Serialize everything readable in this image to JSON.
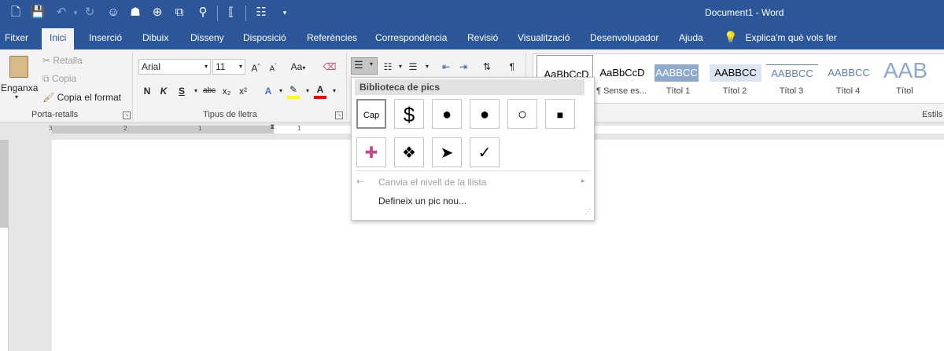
{
  "window": {
    "title": "Document1  -  Word"
  },
  "qat": {
    "icons": [
      "new-document-icon",
      "save-icon",
      "undo-icon",
      "redo-icon",
      "smiley-icon",
      "globe-icon",
      "zoom-icon",
      "copy-icon",
      "user-icon",
      "bracket-icon",
      "view-icon",
      "customize-icon"
    ]
  },
  "tabs": [
    "Fitxer",
    "Inici",
    "Inserció",
    "Dibuix",
    "Disseny",
    "Disposició",
    "Referències",
    "Correspondència",
    "Revisió",
    "Visualització",
    "Desenvolupador",
    "Ajuda"
  ],
  "tell_me": "Explica'm què vols fer",
  "clipboard": {
    "paste": "Enganxa",
    "cut": "Retalla",
    "copy": "Copia",
    "format_painter": "Copia el format",
    "group": "Porta-retalls"
  },
  "font": {
    "name": "Arial",
    "size": "11",
    "bold": "N",
    "italic": "K",
    "underline": "S",
    "strike": "abc",
    "sub": "x₂",
    "sup": "x²",
    "case": "Aa",
    "group": "Tipus de lletra"
  },
  "styles": {
    "items": [
      {
        "preview": "AaBbCcD",
        "name": ""
      },
      {
        "preview": "AaBbCcD",
        "name": "¶ Sense es..."
      },
      {
        "preview": "AABBCC",
        "name": "Títol 1"
      },
      {
        "preview": "AABBCC",
        "name": "Títol 2"
      },
      {
        "preview": "AABBCC",
        "name": "Títol 3"
      },
      {
        "preview": "AABBCC",
        "name": "Títol 4"
      },
      {
        "preview": "AAB",
        "name": "Títol"
      }
    ],
    "group": "Estils"
  },
  "bullet_dropdown": {
    "header": "Biblioteca de pics",
    "bullets": [
      "Cap",
      "$",
      "●",
      "●",
      "○",
      "■",
      "✚",
      "❖",
      "➤",
      "✓"
    ],
    "change_level": "Canvia el nivell de la llista",
    "define_new": "Defineix un pic nou..."
  },
  "ruler": {
    "numbers": [
      "3",
      "1",
      "2",
      "1"
    ]
  },
  "colors": {
    "accent": "#2b579a",
    "highlight": "#ffff00",
    "font_color": "#ff0000"
  }
}
